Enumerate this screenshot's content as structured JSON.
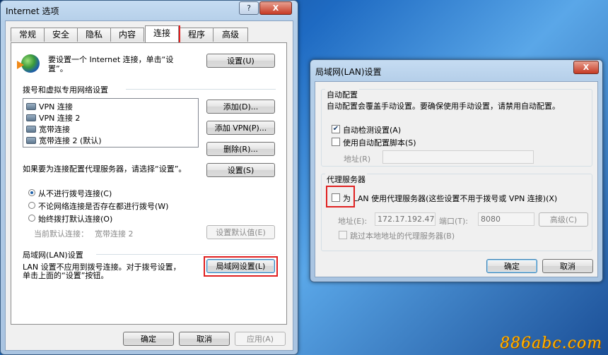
{
  "internet_options": {
    "title": "Internet 选项",
    "help_btn": "?",
    "close_btn": "X",
    "tabs": [
      "常规",
      "安全",
      "隐私",
      "内容",
      "连接",
      "程序",
      "高级"
    ],
    "setup_text": "要设置一个 Internet 连接，单击“设置”。",
    "setup_btn": "设置(U)",
    "dialup_heading": "拨号和虚拟专用网络设置",
    "connections": [
      "VPN 连接",
      "VPN 连接 2",
      "宽带连接",
      "宽带连接 2 (默认)"
    ],
    "add_btn": "添加(D)...",
    "add_vpn_btn": "添加 VPN(P)...",
    "remove_btn": "删除(R)...",
    "proxy_text": "如果要为连接配置代理服务器，请选择“设置”。",
    "settings_btn": "设置(S)",
    "radio_options": [
      "从不进行拨号连接(C)",
      "不论网络连接是否存在都进行拨号(W)",
      "始终拨打默认连接(O)"
    ],
    "current_default_label": "当前默认连接：",
    "current_default_value": "宽带连接 2",
    "set_default_btn": "设置默认值(E)",
    "lan_heading": "局域网(LAN)设置",
    "lan_text": "LAN 设置不应用到拨号连接。对于拨号设置，单击上面的“设置”按钮。",
    "lan_btn": "局域网设置(L)",
    "ok_btn": "确定",
    "cancel_btn": "取消",
    "apply_btn": "应用(A)"
  },
  "lan_settings": {
    "title": "局域网(LAN)设置",
    "close_btn": "X",
    "auto_heading": "自动配置",
    "auto_desc": "自动配置会覆盖手动设置。要确保使用手动设置，请禁用自动配置。",
    "auto_detect": "自动检测设置(A)",
    "auto_detect_checked": true,
    "use_script": "使用自动配置脚本(S)",
    "use_script_checked": false,
    "address_label": "地址(R)",
    "proxy_heading": "代理服务器",
    "use_proxy": "为 LAN 使用代理服务器(这些设置不用于拨号或 VPN 连接)(X)",
    "use_proxy_checked": false,
    "proxy_addr_label": "地址(E):",
    "proxy_addr": "172.17.192.47",
    "port_label": "端口(T):",
    "port": "8080",
    "advanced_btn": "高级(C)",
    "bypass_local": "跳过本地地址的代理服务器(B)",
    "ok_btn": "确定",
    "cancel_btn": "取消"
  },
  "watermark": "886abc.com"
}
